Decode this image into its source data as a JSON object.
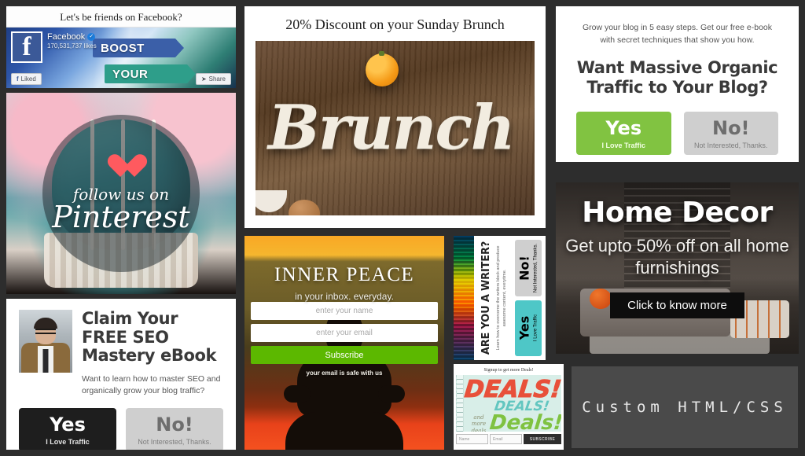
{
  "gallery": {
    "background_color": "#2d2d2d"
  },
  "facebook_panel": {
    "title": "Let's be friends on Facebook?",
    "page_name": "Facebook",
    "verified_icon": "verified-badge",
    "likes": "170,531,737 likes",
    "liked_button": "Liked",
    "share_button": "Share",
    "cover_line_1": "BOOST",
    "cover_line_2": "YOUR",
    "logo_glyph": "f"
  },
  "pinterest_panel": {
    "follow_text": "follow us on",
    "network": "Pinterest",
    "heart_icon": "heart-icon"
  },
  "seo_panel": {
    "headline": "Claim Your FREE SEO Mastery eBook",
    "subtext": "Want to learn how to master SEO and organically grow your blog traffic?",
    "yes_label": "Yes",
    "yes_sublabel": "I Love Traffic",
    "no_label": "No!",
    "no_sublabel": "Not Interested, Thanks.",
    "yes_color": "#1e1e1e",
    "no_color": "#cfcfcf"
  },
  "brunch_panel": {
    "title": "20% Discount on your Sunday Brunch",
    "photo_word": "Brunch"
  },
  "inner_peace_panel": {
    "title": "INNER PEACE",
    "subtitle": "in your inbox. everyday.",
    "name_placeholder": "enter your name",
    "email_placeholder": "enter your email",
    "subscribe_label": "Subscribe",
    "safety_note": "your email is safe with us",
    "subscribe_color": "#5cb800"
  },
  "writer_panel": {
    "headline": "ARE YOU A WRITER?",
    "subtext": "Learn how to overcome the writers block and produce awesome content, everytime.",
    "yes_label": "Yes",
    "yes_sublabel": "I Love Traffic",
    "no_label": "No!",
    "no_sublabel": "Not Interested, Thanks.",
    "yes_color": "#4ec7c7",
    "no_color": "#cfcfcf"
  },
  "deals_panel": {
    "header": "Signup to get more Deals!",
    "art_word_1": "DEALS!",
    "art_word_2": "DEALS!",
    "art_word_3": "Deals!",
    "art_word_4": "and more deals",
    "name_placeholder": "Name",
    "email_placeholder": "Email",
    "subscribe_label": "SUBSCRIBE"
  },
  "traffic_panel": {
    "subtext": "Grow your blog in 5 easy steps. Get our free e-book with secret techniques that show you how.",
    "headline": "Want Massive Organic Traffic to Your Blog?",
    "yes_label": "Yes",
    "yes_sublabel": "I Love Traffic",
    "no_label": "No!",
    "no_sublabel": "Not Interested, Thanks.",
    "yes_color": "#81c341",
    "no_color": "#cfcfcf"
  },
  "home_decor_panel": {
    "title": "Home Decor",
    "subtitle": "Get upto 50% off on all home furnishings",
    "cta_label": "Click to know more"
  },
  "custom_panel": {
    "label": "Custom HTML/CSS",
    "background_color": "#4a4a4a"
  }
}
